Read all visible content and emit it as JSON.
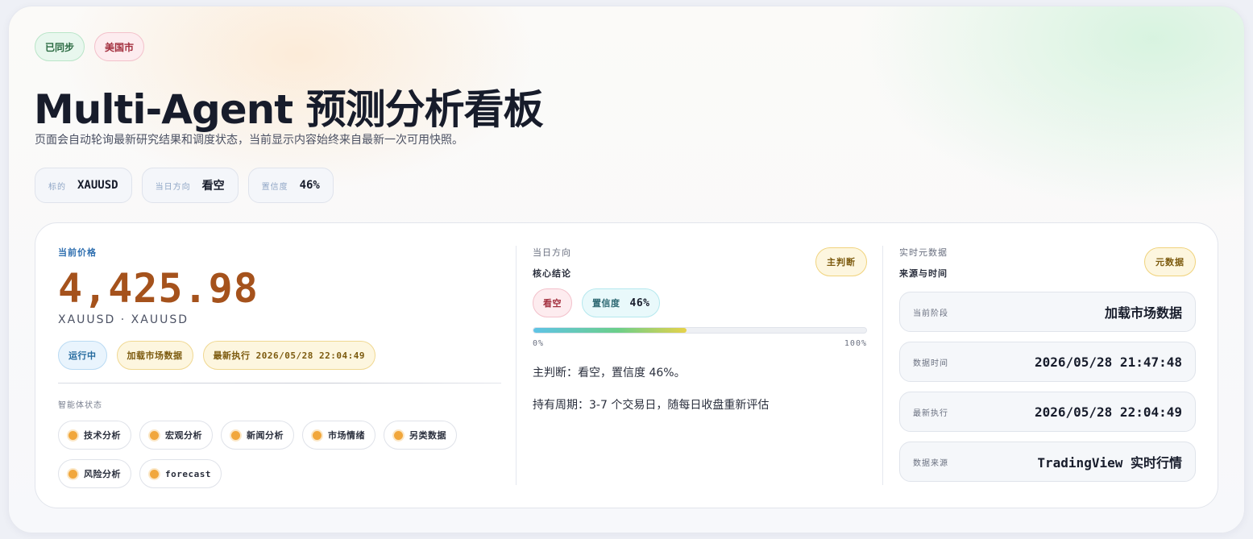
{
  "header": {
    "badges": [
      "已同步",
      "美国市"
    ],
    "title": "Multi-Agent 预测分析看板",
    "subtitle": "页面会自动轮询最新研究结果和调度状态，当前显示内容始终来自最新一次可用快照。"
  },
  "summary_chips": [
    {
      "label": "标的",
      "value": "XAUUSD"
    },
    {
      "label": "当日方向",
      "value": "看空"
    },
    {
      "label": "置信度",
      "value": "46%"
    }
  ],
  "price_panel": {
    "label": "当前价格",
    "price": "4,425.98",
    "pair": "XAUUSD · XAUUSD",
    "status_tags": [
      "运行中",
      "加载市场数据",
      "最新执行 2026/05/28 22:04:49"
    ],
    "agents_label": "智能体状态",
    "agents": [
      "技术分析",
      "宏观分析",
      "新闻分析",
      "市场情绪",
      "另类数据",
      "风险分析",
      "forecast"
    ],
    "agent_status_color": "#f1a73c"
  },
  "direction_panel": {
    "label": "当日方向",
    "sub_label": "核心结论",
    "corner_tag": "主判断",
    "direction": "看空",
    "confidence_label": "置信度",
    "confidence_value": "46%",
    "confidence_fraction": 0.46,
    "bar_min": "0%",
    "bar_max": "100%",
    "verdict": "主判断：看空，置信度 46%。",
    "holding": "持有周期：3-7 个交易日，随每日收盘重新评估"
  },
  "meta_panel": {
    "label": "实时元数据",
    "sub_label": "来源与时间",
    "corner_tag": "元数据",
    "rows": [
      {
        "key": "当前阶段",
        "value": "加载市场数据"
      },
      {
        "key": "数据时间",
        "value": "2026/05/28 21:47:48"
      },
      {
        "key": "最新执行",
        "value": "2026/05/28 22:04:49"
      },
      {
        "key": "数据来源",
        "value": "TradingView 实时行情"
      }
    ]
  },
  "colors": {
    "price": "#a5521c",
    "accent_blue": "#2f6fb0",
    "bearish": "#a3303f"
  }
}
